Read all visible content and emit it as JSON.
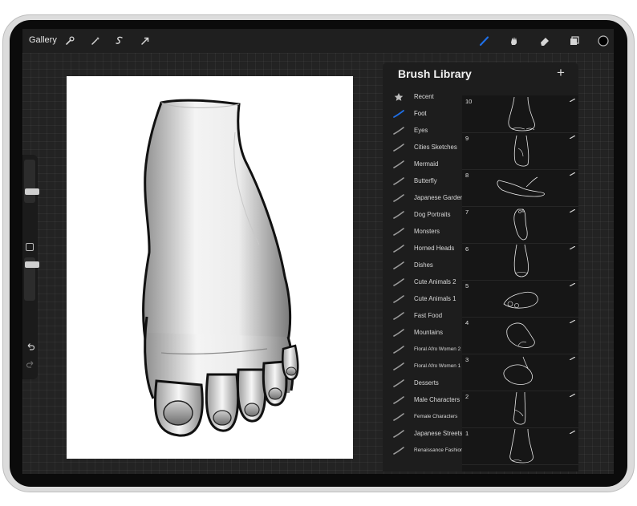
{
  "topbar": {
    "gallery_label": "Gallery",
    "left_tools": [
      "wrench-icon",
      "magic-wand-icon",
      "selection-icon",
      "move-arrow-icon"
    ],
    "right_tools": [
      "brush-icon",
      "smudge-icon",
      "eraser-icon",
      "layers-icon",
      "color-icon"
    ],
    "active_color": "#1f6fe6"
  },
  "brush_library": {
    "title": "Brush Library",
    "add_label": "+",
    "sets": [
      {
        "label": "Recent",
        "icon": "star-icon"
      },
      {
        "label": "Foot",
        "icon": "brush-stroke-icon",
        "active": true
      },
      {
        "label": "Eyes",
        "icon": "brush-stroke-icon"
      },
      {
        "label": "Cities Sketches",
        "icon": "brush-stroke-icon"
      },
      {
        "label": "Mermaid",
        "icon": "brush-stroke-icon"
      },
      {
        "label": "Butterfly",
        "icon": "brush-stroke-icon"
      },
      {
        "label": "Japanese Garden",
        "icon": "brush-stroke-icon"
      },
      {
        "label": "Dog Portraits",
        "icon": "brush-stroke-icon"
      },
      {
        "label": "Monsters",
        "icon": "brush-stroke-icon"
      },
      {
        "label": "Horned Heads",
        "icon": "brush-stroke-icon"
      },
      {
        "label": "Dishes",
        "icon": "brush-stroke-icon"
      },
      {
        "label": "Cute Animals 2",
        "icon": "brush-stroke-icon"
      },
      {
        "label": "Cute Animals 1",
        "icon": "brush-stroke-icon"
      },
      {
        "label": "Fast Food",
        "icon": "brush-stroke-icon"
      },
      {
        "label": "Mountains",
        "icon": "brush-stroke-icon"
      },
      {
        "label": "Floral Afro Women 2",
        "icon": "brush-stroke-icon",
        "small": true
      },
      {
        "label": "Floral Afro Women 1",
        "icon": "brush-stroke-icon",
        "small": true
      },
      {
        "label": "Desserts",
        "icon": "brush-stroke-icon"
      },
      {
        "label": "Male Characters",
        "icon": "brush-stroke-icon"
      },
      {
        "label": "Female Characters",
        "icon": "brush-stroke-icon",
        "small": true
      },
      {
        "label": "Japanese Streets",
        "icon": "brush-stroke-icon"
      },
      {
        "label": "Renaissance Fashion",
        "icon": "brush-stroke-icon",
        "small": true
      }
    ],
    "brushes": [
      {
        "number": "10",
        "thumbnail": "foot-front-view-sketch"
      },
      {
        "number": "9",
        "thumbnail": "foot-side-view-sketch"
      },
      {
        "number": "8",
        "thumbnail": "foot-profile-sketch"
      },
      {
        "number": "7",
        "thumbnail": "foot-sole-sketch"
      },
      {
        "number": "6",
        "thumbnail": "foot-top-view-sketch"
      },
      {
        "number": "5",
        "thumbnail": "foot-toes-sketch"
      },
      {
        "number": "4",
        "thumbnail": "foot-three-quarter-sketch"
      },
      {
        "number": "3",
        "thumbnail": "foot-heel-sketch"
      },
      {
        "number": "2",
        "thumbnail": "foot-ankle-sketch"
      },
      {
        "number": "1",
        "thumbnail": "foot-standing-sketch"
      }
    ]
  }
}
